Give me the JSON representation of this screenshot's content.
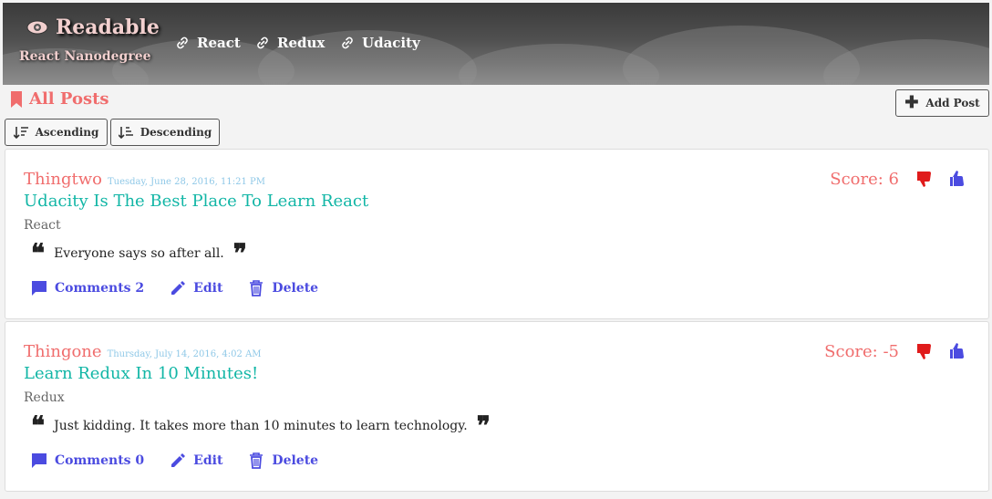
{
  "header": {
    "brand": "Readable",
    "subtitle": "React Nanodegree",
    "nav": [
      "React",
      "Redux",
      "Udacity"
    ]
  },
  "toolbar": {
    "all_posts": "All Posts",
    "add_post": "Add Post",
    "ascending": "Ascending",
    "descending": "Descending"
  },
  "posts": [
    {
      "author": "Thingtwo",
      "date": "Tuesday, June 28, 2016, 11:21 PM",
      "title": "Udacity Is The Best Place To Learn React",
      "category": "React",
      "body": "Everyone says so after all.",
      "score_label": "Score: 6",
      "comments_label": "Comments 2",
      "edit": "Edit",
      "delete": "Delete"
    },
    {
      "author": "Thingone",
      "date": "Thursday, July 14, 2016, 4:02 AM",
      "title": "Learn Redux In 10 Minutes!",
      "category": "Redux",
      "body": "Just kidding. It takes more than 10 minutes to learn technology.",
      "score_label": "Score: -5",
      "comments_label": "Comments 0",
      "edit": "Edit",
      "delete": "Delete"
    }
  ],
  "colors": {
    "accent": "#f06d6d",
    "title": "#12b6a6",
    "action": "#4b4be0",
    "thumb_down": "#e01b1b",
    "thumb_up": "#4b4be0"
  }
}
